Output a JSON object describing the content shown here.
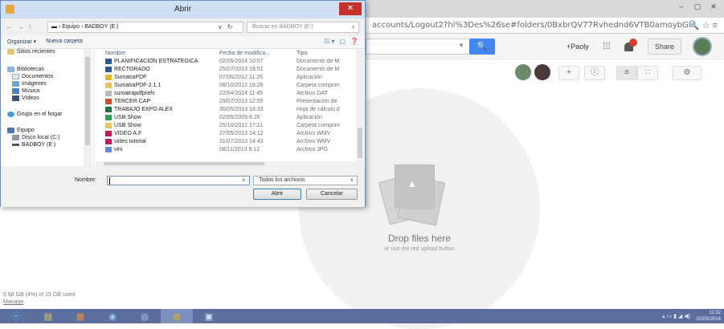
{
  "browser": {
    "url": "accounts/Logout2?hl%3Des%26se#folders/0BxbrQV77Rvhednd6VTB0amoybGM",
    "win_buttons": [
      "–",
      "▢",
      "✕"
    ],
    "addr_icons": "🔍 ☆ ≡"
  },
  "drive": {
    "search_button": "🔍",
    "user": "+Paoly",
    "share": "Share",
    "drop_title": "Drop files here",
    "drop_sub": "or use the red upload button",
    "storage": "0.68 GB (4%) of 15 GB used",
    "manage": "Manage",
    "tools": [
      "+",
      "ⓘ",
      "≡",
      "∷",
      "⚙"
    ]
  },
  "dialog": {
    "title": "Abrir",
    "close": "✕",
    "nav_arrows": [
      "←",
      "→",
      "↑"
    ],
    "breadcrumb": "▬ › Equipo › BADBOY (E:)",
    "bc_controls": [
      "∨",
      "↻"
    ],
    "search_placeholder": "Buscar en BADBOY (E:)",
    "toolbar": {
      "organize": "Organizar ▾",
      "new_folder": "Nueva carpeta"
    },
    "toolbar_icons": [
      "☷ ▾",
      "▢",
      "❓"
    ],
    "nav": [
      {
        "label": "Sitios recientes",
        "icon": "recent-icon"
      },
      {
        "label": "Bibliotecas",
        "icon": "library-icon"
      },
      {
        "label": "Documentos",
        "icon": "documents-icon"
      },
      {
        "label": "Imágenes",
        "icon": "images-icon"
      },
      {
        "label": "Música",
        "icon": "music-icon"
      },
      {
        "label": "Vídeos",
        "icon": "videos-icon"
      },
      {
        "label": "Grupo en el hogar",
        "icon": "homegroup-icon"
      },
      {
        "label": "Equipo",
        "icon": "computer-icon"
      },
      {
        "label": "Disco local (C:)",
        "icon": "drive-icon"
      },
      {
        "label": "BADBOY (E:)",
        "icon": "usb-drive-icon"
      }
    ],
    "columns": {
      "name": "Nombre",
      "date": "Fecha de modifica...",
      "type": "Tipo"
    },
    "files": [
      {
        "name": "PLANIFICACION ESTRATEGICA",
        "date": "02/05/2014 10:57",
        "type": "Documento de M",
        "icon": "word-doc-icon",
        "color": "#2b5797"
      },
      {
        "name": "RECTORADO",
        "date": "25/07/2013 19:51",
        "type": "Documento de M",
        "icon": "word-doc-icon",
        "color": "#2b5797"
      },
      {
        "name": "SumatraPDF",
        "date": "07/05/2012 11:26",
        "type": "Aplicación",
        "icon": "app-icon",
        "color": "#e3b62a"
      },
      {
        "name": "SumatraPDF-2.1.1",
        "date": "08/10/2012 19:26",
        "type": "Carpeta comprim",
        "icon": "zip-folder-icon",
        "color": "#e8c35a"
      },
      {
        "name": "sumatrapdfprefs",
        "date": "22/04/2014 11:45",
        "type": "Archivo DAT",
        "icon": "file-icon",
        "color": "#bbbbbb"
      },
      {
        "name": "TERCER CAP",
        "date": "29/07/2013 12:55",
        "type": "Presentación de",
        "icon": "ppt-icon",
        "color": "#d04a2b"
      },
      {
        "name": "TRABAJO EXPO ALEX",
        "date": "30/05/2013 18:33",
        "type": "Hoja de cálculo d",
        "icon": "excel-icon",
        "color": "#217346"
      },
      {
        "name": "USB Show",
        "date": "02/05/2009 8:26",
        "type": "Aplicación",
        "icon": "app-icon",
        "color": "#2aa14a"
      },
      {
        "name": "USB Show",
        "date": "25/10/2012 17:11",
        "type": "Carpeta comprim",
        "icon": "zip-folder-icon",
        "color": "#e8c35a"
      },
      {
        "name": "VIDEO A.F",
        "date": "27/05/2013 14:12",
        "type": "Archivo WMV",
        "icon": "video-icon",
        "color": "#c2185b"
      },
      {
        "name": "video tutorial",
        "date": "31/07/2013 14:43",
        "type": "Archivo WMV",
        "icon": "video-icon",
        "color": "#c2185b"
      },
      {
        "name": "vini",
        "date": "08/11/2013 9:12",
        "type": "Archivo JPG",
        "icon": "image-file-icon",
        "color": "#5b8fd6"
      }
    ],
    "filename_label": "Nombre:",
    "filename_value": "",
    "filetype": "Todos los archivos",
    "open": "Abrir",
    "cancel": "Cancelar"
  },
  "taskbar": {
    "items": [
      "ⓔ",
      "▤",
      "▦",
      "◉",
      "◎",
      "◍",
      "▣"
    ],
    "tray": "▴ ▭ ▮ ◢ ◀)",
    "time": "11:32",
    "date": "02/05/2014"
  }
}
